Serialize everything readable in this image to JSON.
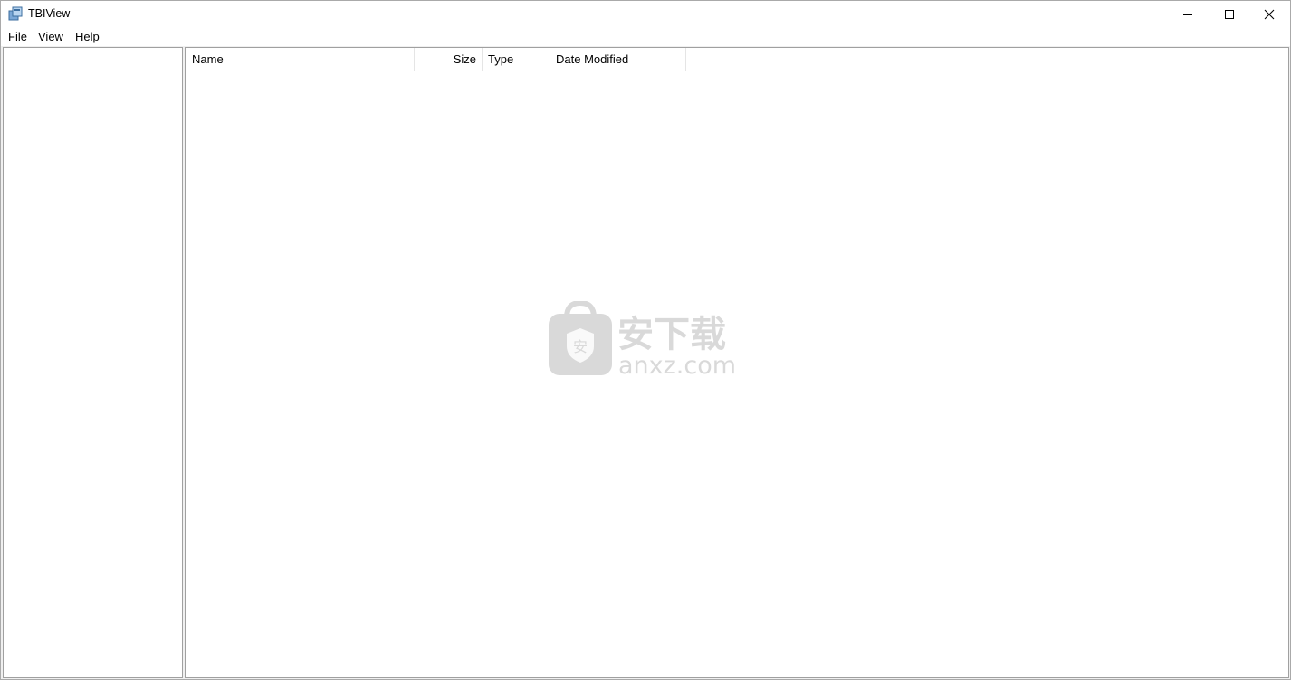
{
  "window": {
    "title": "TBIView"
  },
  "titlebar_buttons": {
    "minimize": "minimize-icon",
    "maximize": "maximize-icon",
    "close": "close-icon"
  },
  "menu": {
    "file": "File",
    "view": "View",
    "help": "Help"
  },
  "list": {
    "columns": [
      {
        "label": "Name"
      },
      {
        "label": "Size"
      },
      {
        "label": "Type"
      },
      {
        "label": "Date Modified"
      }
    ],
    "rows": []
  },
  "watermark": {
    "cn_text": "安下载",
    "domain": "anxz.com",
    "badge": "安"
  }
}
